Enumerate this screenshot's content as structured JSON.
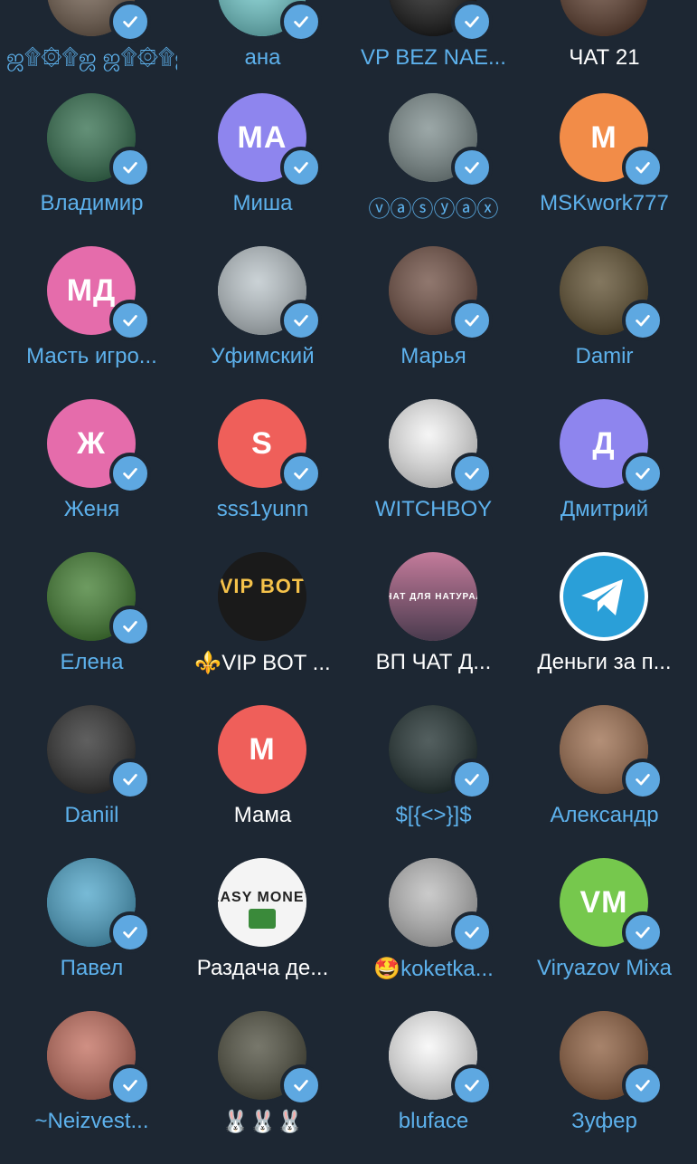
{
  "contacts": [
    {
      "name": "ஜ۩۞۩ஜ ஜ۩۞۩ஜ",
      "initials": "",
      "bg": "#6d5a4a",
      "verified": true,
      "name_color": "accent"
    },
    {
      "name": "ана",
      "initials": "",
      "bg": "#6ec9cb",
      "verified": true,
      "name_color": "accent"
    },
    {
      "name": "VP BEZ NAE...",
      "initials": "",
      "bg": "#111111",
      "verified": true,
      "name_color": "accent"
    },
    {
      "name": "ЧАТ 21",
      "initials": "",
      "bg": "#5a3a2a",
      "verified": false,
      "name_color": "plain"
    },
    {
      "name": "Владимир",
      "initials": "",
      "bg": "#2f6b4a",
      "verified": true,
      "name_color": "accent"
    },
    {
      "name": "Миша",
      "initials": "МА",
      "bg": "#8e85ee",
      "verified": true,
      "name_color": "accent"
    },
    {
      "name": "ⓥⓐⓢⓨⓐⓧ",
      "initials": "",
      "bg": "#7a8a8a",
      "verified": true,
      "name_color": "accent"
    },
    {
      "name": "MSKwork777",
      "initials": "M",
      "bg": "#f28c48",
      "verified": true,
      "name_color": "accent"
    },
    {
      "name": "Масть игро...",
      "initials": "МД",
      "bg": "#e56cab",
      "verified": true,
      "name_color": "accent"
    },
    {
      "name": "Уфимский",
      "initials": "",
      "bg": "#b9c3c8",
      "verified": true,
      "name_color": "accent"
    },
    {
      "name": "Марья",
      "initials": "",
      "bg": "#6b4a3e",
      "verified": true,
      "name_color": "accent"
    },
    {
      "name": "Damir",
      "initials": "",
      "bg": "#5a4a2a",
      "verified": true,
      "name_color": "accent"
    },
    {
      "name": "Женя",
      "initials": "Ж",
      "bg": "#e56cab",
      "verified": true,
      "name_color": "accent"
    },
    {
      "name": "sss1yunn",
      "initials": "S",
      "bg": "#ef5f5a",
      "verified": true,
      "name_color": "accent"
    },
    {
      "name": "WITCHBOY",
      "initials": "",
      "bg": "#f2f2f2",
      "verified": true,
      "name_color": "accent"
    },
    {
      "name": "Дмитрий",
      "initials": "Д",
      "bg": "#8e85ee",
      "verified": true,
      "name_color": "accent"
    },
    {
      "name": "Елена",
      "initials": "",
      "bg": "#3d7a2c",
      "verified": true,
      "name_color": "accent"
    },
    {
      "name": "⚜️VIP BOT ...",
      "initials": "",
      "bg": "#1a1a1a",
      "verified": false,
      "name_color": "plain"
    },
    {
      "name": "ВП ЧАТ Д...",
      "initials": "",
      "bg": "#8a5a6e",
      "verified": false,
      "name_color": "plain"
    },
    {
      "name": "Деньги за п...",
      "initials": "",
      "bg": "#ffffff",
      "verified": false,
      "name_color": "plain"
    },
    {
      "name": "Daniil",
      "initials": "",
      "bg": "#2a2a2a",
      "verified": true,
      "name_color": "accent"
    },
    {
      "name": "Мама",
      "initials": "M",
      "bg": "#ef5f5a",
      "verified": false,
      "name_color": "plain"
    },
    {
      "name": "$[{<>}]$",
      "initials": "",
      "bg": "#1a2a2a",
      "verified": true,
      "name_color": "accent"
    },
    {
      "name": "Александр",
      "initials": "",
      "bg": "#9a6a4a",
      "verified": true,
      "name_color": "accent"
    },
    {
      "name": "Павел",
      "initials": "",
      "bg": "#4aa3c8",
      "verified": true,
      "name_color": "accent"
    },
    {
      "name": "Раздача де...",
      "initials": "",
      "bg": "#f4f4f4",
      "verified": false,
      "name_color": "plain"
    },
    {
      "name": "🤩koketka...",
      "initials": "",
      "bg": "#b9b9b9",
      "verified": true,
      "name_color": "accent"
    },
    {
      "name": "Viryazov Mixa",
      "initials": "VM",
      "bg": "#76c84d",
      "verified": true,
      "name_color": "accent"
    },
    {
      "name": "~Neizvest...",
      "initials": "",
      "bg": "#c06a5a",
      "verified": true,
      "name_color": "accent"
    },
    {
      "name": "🐰🐰🐰",
      "initials": "",
      "bg": "#4a4a3a",
      "verified": true,
      "name_color": "plain"
    },
    {
      "name": "bluface",
      "initials": "",
      "bg": "#f6f6f6",
      "verified": true,
      "name_color": "accent"
    },
    {
      "name": "Зуфер",
      "initials": "",
      "bg": "#8a5a3a",
      "verified": true,
      "name_color": "accent"
    }
  ],
  "colors": {
    "background": "#1d2733",
    "accent": "#5db1ec",
    "plain": "#ffffff",
    "check": "#5ea8e1"
  },
  "icons": {
    "verified": "check-icon",
    "telegram": "telegram-plane-icon"
  },
  "avatar_texts": {
    "vip_bot": "VIP BOT",
    "vp_chat": "ВП ЧАТ ДЛЯ НАТУРАЛОВ",
    "easy_money": "EASY MONEY"
  }
}
